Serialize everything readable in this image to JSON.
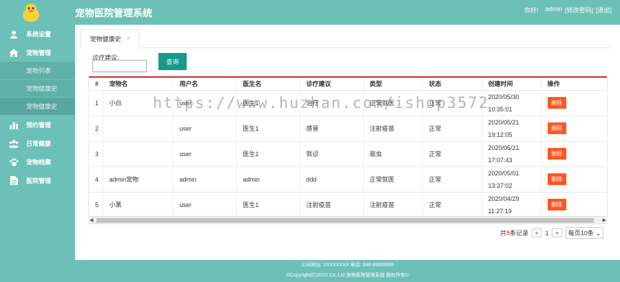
{
  "app": {
    "title": "宠物医院管理系统"
  },
  "user": {
    "greeting": "你好!",
    "name": "admin",
    "change_password": "[修改密码]",
    "logout": "[退出]"
  },
  "sidebar": {
    "items": [
      {
        "label": "系统设置",
        "icon": "user-icon"
      },
      {
        "label": "宠物管理",
        "icon": "home-icon"
      },
      {
        "label": "预约管理",
        "icon": "bar-chart-icon"
      },
      {
        "label": "日常健康",
        "icon": "users-icon"
      },
      {
        "label": "宠物档案",
        "icon": "paw-icon"
      },
      {
        "label": "医院管理",
        "icon": "document-icon"
      }
    ],
    "sub_items": [
      {
        "label": "宠物列表"
      },
      {
        "label": "宠物健康史"
      },
      {
        "label": "宠物健康史"
      }
    ]
  },
  "tabs": [
    {
      "label": "宠物健康史",
      "close": "×"
    }
  ],
  "filter": {
    "label": "诊疗建议:",
    "value": "",
    "query_label": "查询"
  },
  "table": {
    "headers": [
      "#",
      "宠物名",
      "用户名",
      "医生名",
      "诊疗建议",
      "类型",
      "状态",
      "创建时间",
      "操作"
    ],
    "action_label": "删除",
    "rows": [
      {
        "no": "1",
        "pet": "小白",
        "user": "user",
        "doctor": "医生1",
        "advice": "治疗",
        "type": "正常就医",
        "status": "正常",
        "date": "2020/05/30",
        "time": "10:35:01"
      },
      {
        "no": "2",
        "pet": "",
        "user": "user",
        "doctor": "医生1",
        "advice": "感冒",
        "type": "注射疫苗",
        "status": "正常",
        "date": "2020/05/21",
        "time": "19:12:05"
      },
      {
        "no": "3",
        "pet": "",
        "user": "user",
        "doctor": "医生1",
        "advice": "就诊",
        "type": "驱虫",
        "status": "正常",
        "date": "2020/05/21",
        "time": "17:07:43"
      },
      {
        "no": "4",
        "pet": "admin宠物",
        "user": "admin",
        "doctor": "admin",
        "advice": "ddd",
        "type": "正常就医",
        "status": "正常",
        "date": "2020/05/01",
        "time": "13:37:02"
      },
      {
        "no": "5",
        "pet": "小黑",
        "user": "user",
        "doctor": "医生1",
        "advice": "注射疫苗",
        "type": "注射疫苗",
        "status": "正常",
        "date": "2020/04/29",
        "time": "11:27:19"
      }
    ]
  },
  "pagination": {
    "total_prefix": "共",
    "total_count": "5",
    "total_suffix": "条记录",
    "prev": "«",
    "page": "1",
    "next": "»",
    "page_size": "每页10条"
  },
  "footer": {
    "line1": "公司地址: XXXXXXXX 电话: 088-88889999",
    "line2": "©Copyright(C)2020 Co.,Ltd 宠物医院管理系统 版权所有©"
  },
  "watermark": "https://www.huzhan.com/ishop3572",
  "colors": {
    "theme": "#6cc0b8",
    "query_button": "#179a8a",
    "delete_button": "#ff5722",
    "accent_line": "#c9302c"
  }
}
